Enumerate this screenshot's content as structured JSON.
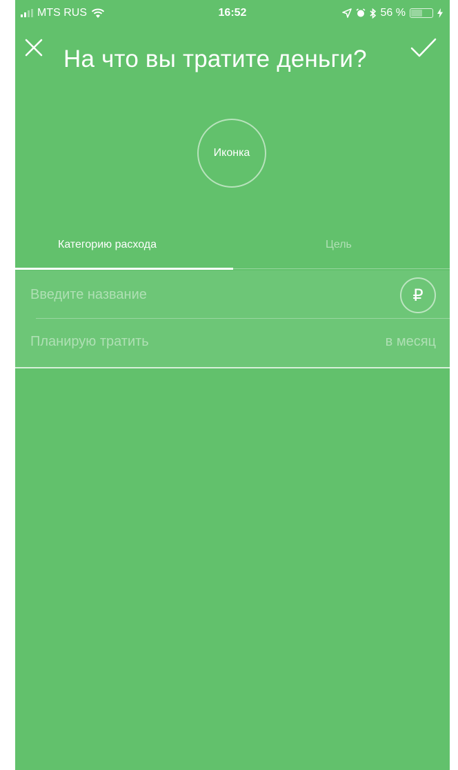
{
  "status_bar": {
    "carrier": "MTS RUS",
    "time": "16:52",
    "battery": "56 %",
    "battery_level": 0.56
  },
  "header": {
    "title": "На что вы тратите деньги?",
    "close_icon": "close-icon",
    "confirm_icon": "checkmark-icon"
  },
  "icon_picker": {
    "label": "Иконка"
  },
  "tabs": [
    {
      "label": "Категорию расхода",
      "active": true
    },
    {
      "label": "Цель",
      "active": false
    }
  ],
  "form": {
    "name_placeholder": "Введите название",
    "name_value": "",
    "currency_symbol": "₽",
    "plan_label": "Планирую тратить",
    "period_label": "в месяц"
  },
  "colors": {
    "background": "#62c16c",
    "form_background": "#6dc677",
    "accent": "#ffffff"
  }
}
